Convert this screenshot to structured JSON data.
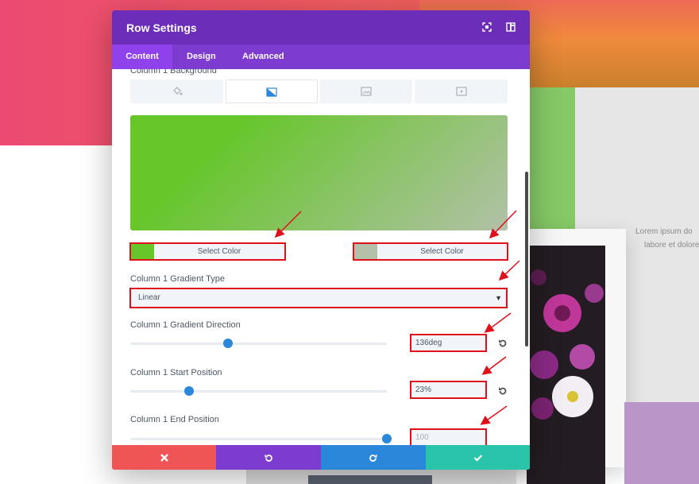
{
  "background": {
    "lorem_line1": "Lorem ipsum do",
    "lorem_line2": "labore et dolore"
  },
  "modal": {
    "title": "Row Settings",
    "header_icons": [
      "expand-icon",
      "split-view-icon"
    ],
    "tabs": [
      {
        "label": "Content",
        "active": true
      },
      {
        "label": "Design",
        "active": false
      },
      {
        "label": "Advanced",
        "active": false
      }
    ],
    "background_section": {
      "label": "Column 1 Background",
      "types": [
        "color-fill-icon",
        "gradient-icon",
        "image-icon",
        "video-icon"
      ],
      "active_type": "gradient-icon"
    },
    "gradient": {
      "start_color": "#66c62a",
      "end_color": "#b2c1a8",
      "color_button_1": "Select Color",
      "color_button_2": "Select Color"
    },
    "gradient_type": {
      "label": "Column 1 Gradient Type",
      "value": "Linear"
    },
    "direction": {
      "label": "Column 1 Gradient Direction",
      "value": "136deg",
      "slider_fraction": 0.38
    },
    "start_position": {
      "label": "Column 1 Start Position",
      "value": "23%",
      "slider_fraction": 0.23
    },
    "end_position": {
      "label": "Column 1 End Position",
      "placeholder": "100",
      "slider_fraction": 1.0
    },
    "footer": {
      "buttons": [
        "close-icon",
        "undo-icon",
        "redo-icon",
        "check-icon"
      ],
      "colors": {
        "cancel": "#ef5555",
        "undo": "#7e3bd0",
        "redo": "#2b87da",
        "save": "#29c4a9"
      }
    }
  },
  "colors": {
    "header": "#6c2eb9",
    "tabs": "#7e3bd0",
    "active_tab": "#8f42ec",
    "highlight_border": "#e0101a",
    "slider_thumb": "#2b87da"
  }
}
